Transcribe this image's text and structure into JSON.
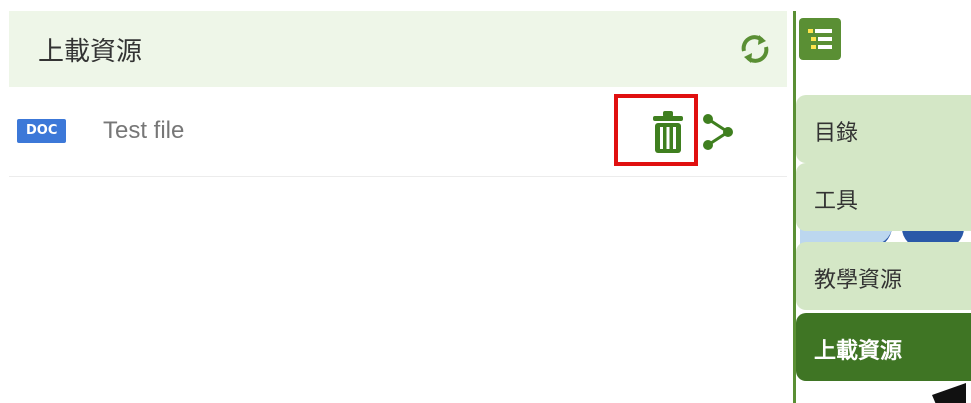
{
  "panel": {
    "title": "上載資源",
    "refresh_icon": "refresh-icon"
  },
  "file": {
    "type_badge": "DOC",
    "name": "Test file",
    "delete_icon": "trash-icon",
    "share_icon": "share-icon"
  },
  "side_nav": {
    "toc_icon": "list-icon",
    "tabs": [
      {
        "label": "目錄",
        "active": false
      },
      {
        "label": "工具",
        "active": false
      },
      {
        "label": "教學資源",
        "active": false
      },
      {
        "label": "上載資源",
        "active": true
      }
    ]
  },
  "colors": {
    "accent_green": "#5a8f34",
    "active_tab": "#3f7524",
    "inactive_tab": "#d4e7c6",
    "header_bg": "#eef6e8",
    "badge_blue": "#3c78d8",
    "highlight_red": "#e01010"
  }
}
